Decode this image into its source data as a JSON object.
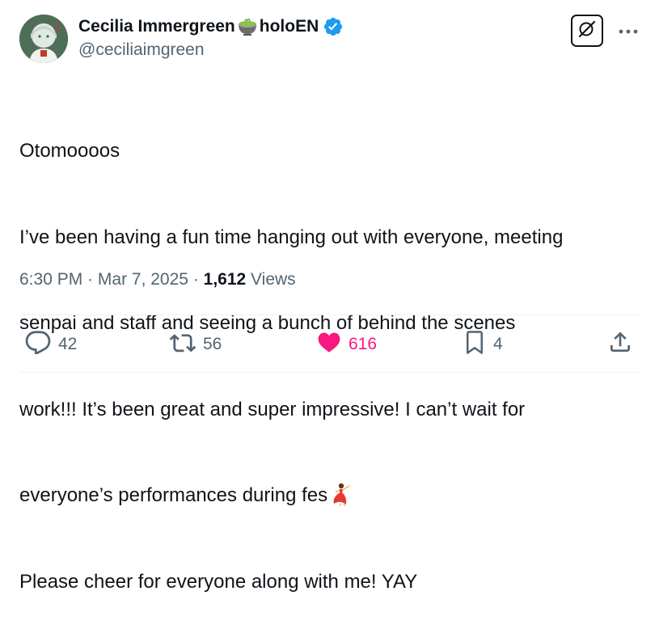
{
  "author": {
    "display_name": "Cecilia Immergreen",
    "display_name_suffix": "holoEN",
    "handle": "@ceciliaimgreen",
    "verified": true
  },
  "tweet": {
    "lines": [
      "Otomoooos",
      "I’ve been having a fun time hanging out with everyone, meeting",
      "senpai and staff and seeing a bunch of behind the scenes",
      "work!!! It’s been great and super impressive! I can’t wait for",
      "everyone’s performances during fes",
      "Please cheer for everyone along with me! YAY"
    ]
  },
  "meta": {
    "time": "6:30 PM",
    "separator": " · ",
    "date": "Mar 7, 2025",
    "views_count": "1,612",
    "views_label": "Views"
  },
  "actions": {
    "replies": "42",
    "reposts": "56",
    "likes": "616",
    "bookmarks": "4"
  },
  "icons": {
    "grok": "grok-icon",
    "more": "more-icon",
    "verified": "verified-badge-icon",
    "reply": "reply-icon",
    "repost": "repost-icon",
    "like": "heart-icon",
    "bookmark": "bookmark-icon",
    "share": "share-icon"
  },
  "colors": {
    "text": "#0f1419",
    "secondary": "#536471",
    "verified": "#1d9bf0",
    "like": "#f91880",
    "divider": "#eff3f4"
  }
}
